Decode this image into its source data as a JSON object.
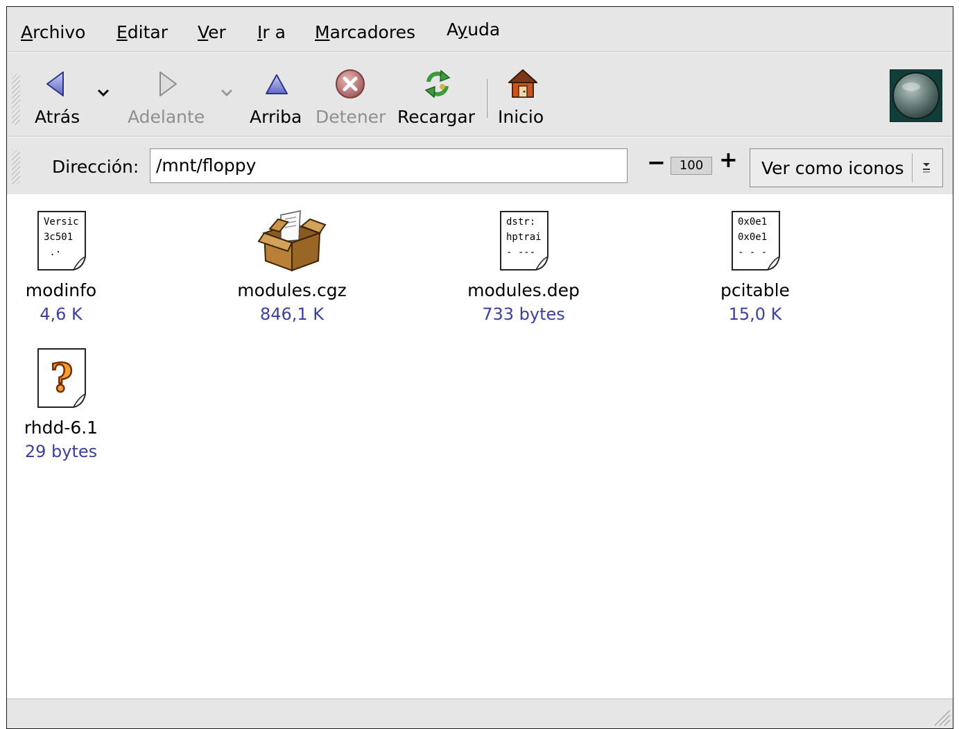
{
  "menubar": {
    "items": [
      {
        "label": "Archivo",
        "mnemonic": "A",
        "rest": "rchivo"
      },
      {
        "label": "Editar",
        "mnemonic": "E",
        "rest": "ditar"
      },
      {
        "label": "Ver",
        "mnemonic": "V",
        "rest": "er"
      },
      {
        "label": "Ir a",
        "mnemonic": "I",
        "rest": "r a"
      },
      {
        "label": "Marcadores",
        "mnemonic": "M",
        "rest": "arcadores"
      },
      {
        "label": "Ayuda",
        "pre": "A",
        "mnemonic": "y",
        "rest": "uda"
      }
    ]
  },
  "toolbar": {
    "back_label": "Atrás",
    "forward_label": "Adelante",
    "up_label": "Arriba",
    "stop_label": "Detener",
    "reload_label": "Recargar",
    "home_label": "Inicio",
    "icons": {
      "back": "arrow-left-icon",
      "forward": "arrow-right-icon",
      "up": "arrow-up-icon",
      "stop": "stop-icon",
      "reload": "reload-icon",
      "home": "home-icon"
    }
  },
  "location": {
    "label": "Dirección:",
    "value": "/mnt/floppy"
  },
  "zoom": {
    "minus": "−",
    "level": "100",
    "plus": "+"
  },
  "view": {
    "selected": "Ver como iconos"
  },
  "files": [
    {
      "name": "modinfo",
      "size": "4,6 K",
      "icon": "text-document-icon",
      "preview": "Versic\n3c501\n .·"
    },
    {
      "name": "modules.cgz",
      "size": "846,1 K",
      "icon": "package-icon"
    },
    {
      "name": "modules.dep",
      "size": "733 bytes",
      "icon": "text-document-icon",
      "preview": "dstr: |\nhptrai\n- ---"
    },
    {
      "name": "pcitable",
      "size": "15,0 K",
      "icon": "text-document-icon",
      "preview": "0x0e1\n0x0e1\n- - -"
    },
    {
      "name": "rhdd-6.1",
      "size": "29 bytes",
      "icon": "unknown-file-icon"
    }
  ],
  "colors": {
    "window_bg": "#e6e6e6",
    "file_size": "#3b3f9e",
    "throbber": "#123e39"
  }
}
